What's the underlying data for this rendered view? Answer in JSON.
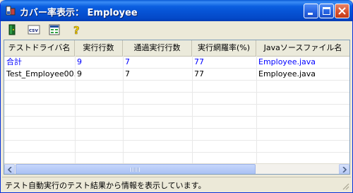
{
  "window": {
    "title": "カバー率表示： Employee",
    "controls": [
      "minimize-icon",
      "maximize-icon",
      "close-icon"
    ]
  },
  "toolbar": {
    "tools": [
      "exit-icon",
      "csv-icon",
      "report-icon",
      "help-icon"
    ]
  },
  "table": {
    "columns": [
      "テストドライバ名",
      "実行行数",
      "通過実行行数",
      "実行網羅率(%)",
      "Javaソースファイル名"
    ],
    "rows": [
      [
        "合計",
        "9",
        "7",
        "77",
        "Employee.java"
      ],
      [
        "Test_Employee00...",
        "9",
        "7",
        "77",
        "Employee.java"
      ]
    ],
    "total_row_color": "#0000ff"
  },
  "status": {
    "text": "テスト自動実行のテスト結果から情報を表示しています。"
  }
}
